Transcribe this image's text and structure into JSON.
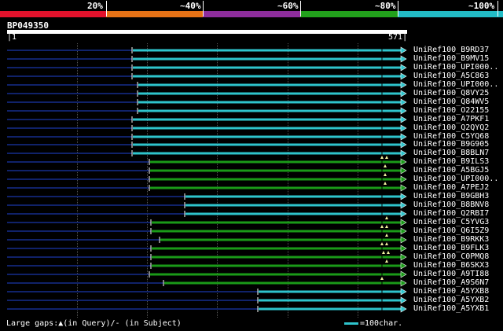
{
  "colors": {
    "band_20": "#e3122c",
    "band_40": "#e67216",
    "band_60": "#8e2d9c",
    "band_80": "#22a11c",
    "band_100": "#22bcc6",
    "cyan": "#2ec4cc",
    "green": "#1a9a18",
    "dark_line": "#10226a",
    "gap_marker": "#f2f2a0"
  },
  "identity_legend": [
    "20%",
    "~40%",
    "~60%",
    "~80%",
    "~100%"
  ],
  "query": {
    "name": "BP049350",
    "start": "1",
    "end": "571"
  },
  "hits": [
    {
      "label": "UniRef100_B9RD37",
      "identity": "100",
      "start": 168,
      "gaps": []
    },
    {
      "label": "UniRef100_B9MV15",
      "identity": "100",
      "start": 168,
      "gaps": []
    },
    {
      "label": "UniRef100_UPI000..",
      "identity": "100",
      "start": 168,
      "gaps": []
    },
    {
      "label": "UniRef100_A5C863",
      "identity": "100",
      "start": 168,
      "gaps": []
    },
    {
      "label": "UniRef100_UPI000..",
      "identity": "100",
      "start": 175,
      "gaps": []
    },
    {
      "label": "UniRef100_Q8VY25",
      "identity": "100",
      "start": 175,
      "gaps": []
    },
    {
      "label": "UniRef100_Q84WV5",
      "identity": "100",
      "start": 175,
      "gaps": []
    },
    {
      "label": "UniRef100_O22155",
      "identity": "100",
      "start": 175,
      "gaps": []
    },
    {
      "label": "UniRef100_A7PKF1",
      "identity": "100",
      "start": 168,
      "gaps": []
    },
    {
      "label": "UniRef100_Q2QYQ2",
      "identity": "100",
      "start": 168,
      "gaps": []
    },
    {
      "label": "UniRef100_C5YQ68",
      "identity": "100",
      "start": 168,
      "gaps": []
    },
    {
      "label": "UniRef100_B9G905",
      "identity": "100",
      "start": 168,
      "gaps": []
    },
    {
      "label": "UniRef100_B8BLN7",
      "identity": "100",
      "start": 168,
      "gaps": []
    },
    {
      "label": "UniRef100_B9ILS3",
      "identity": "80",
      "start": 190,
      "gaps": [
        486,
        492
      ]
    },
    {
      "label": "UniRef100_A5BGJ5",
      "identity": "80",
      "start": 190,
      "gaps": [
        490
      ]
    },
    {
      "label": "UniRef100_UPI000..",
      "identity": "80",
      "start": 190,
      "gaps": [
        490
      ]
    },
    {
      "label": "UniRef100_A7PEJ2",
      "identity": "80",
      "start": 190,
      "gaps": [
        490
      ]
    },
    {
      "label": "UniRef100_B9GBH3",
      "identity": "100",
      "start": 235,
      "gaps": []
    },
    {
      "label": "UniRef100_B8BNV8",
      "identity": "100",
      "start": 235,
      "gaps": []
    },
    {
      "label": "UniRef100_Q2RBI7",
      "identity": "100",
      "start": 235,
      "gaps": []
    },
    {
      "label": "UniRef100_C5YVG3",
      "identity": "80",
      "start": 192,
      "gaps": [
        492
      ]
    },
    {
      "label": "UniRef100_Q6I5Z9",
      "identity": "80",
      "start": 192,
      "gaps": [
        486,
        492
      ]
    },
    {
      "label": "UniRef100_B9RKK3",
      "identity": "80",
      "start": 203,
      "gaps": [
        492
      ]
    },
    {
      "label": "UniRef100_B9FLK3",
      "identity": "80",
      "start": 192,
      "gaps": [
        486,
        492
      ]
    },
    {
      "label": "UniRef100_C0PMQ8",
      "identity": "80",
      "start": 192,
      "gaps": [
        488,
        494
      ]
    },
    {
      "label": "UniRef100_B6SKX3",
      "identity": "80",
      "start": 192,
      "gaps": [
        492
      ]
    },
    {
      "label": "UniRef100_A9TI88",
      "identity": "80",
      "start": 190,
      "gaps": []
    },
    {
      "label": "UniRef100_A9S6N7",
      "identity": "80",
      "start": 208,
      "gaps": [
        486
      ]
    },
    {
      "label": "UniRef100_A5YXB8",
      "identity": "100",
      "start": 328,
      "gaps": []
    },
    {
      "label": "UniRef100_A5YXB2",
      "identity": "100",
      "start": 328,
      "gaps": []
    },
    {
      "label": "UniRef100_A5YXB1",
      "identity": "100",
      "start": 328,
      "gaps": []
    }
  ],
  "legend": {
    "gaps_text": "Large gaps:",
    "gaps_marker": "▲",
    "gaps_mid": "(in Query)/",
    "gaps_dash": "-",
    "gaps_end": " (in Subject)",
    "scale_text": "=100char."
  }
}
